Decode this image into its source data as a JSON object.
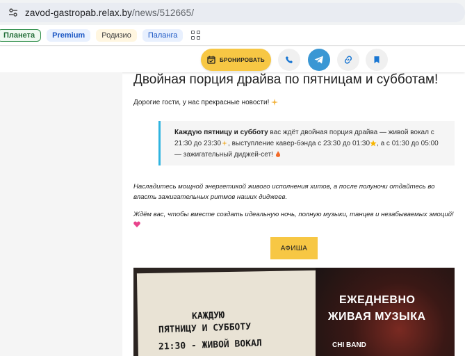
{
  "browser": {
    "url_host": "zavod-gastropab.relax.by",
    "url_path": "/news/512665/"
  },
  "bookmarks": [
    {
      "label": "Планета"
    },
    {
      "label": "Premium"
    },
    {
      "label": "Родизио"
    },
    {
      "label": "Паланга"
    }
  ],
  "actions": {
    "book_label": "БРОНИРОВАТЬ",
    "phone": "phone-icon",
    "telegram": "telegram-icon",
    "link": "link-icon",
    "bookmark": "bookmark-icon"
  },
  "article": {
    "title": "Двойная порция драйва по пятницам и субботам!",
    "intro": "Дорогие гости, у нас прекрасные новости!",
    "quote_bold": "Каждую пятницу и субботу",
    "quote_part1": " вас ждёт двойная порция драйва — живой вокал с 21:30 до 23:30",
    "quote_part2": ", выступление кавер-бэнда с 23:30 до 01:30",
    "quote_part3": ", а с 01:30 до 05:00 — зажигательный диджей-сет!",
    "paragraph1": "Насладитесь мощной энергетикой живого исполнения хитов, а после полуночи отдайтесь во власть зажигательных ритмов наших диджеев.",
    "paragraph2": "Ждём вас, чтобы вместе создать идеальную ночь, полную музыки, танцев и незабываемых эмоций!",
    "afisha_label": "АФИША"
  },
  "poster": {
    "line1": "КАЖДУЮ",
    "line2": "ПЯТНИЦУ И СУББОТУ",
    "line3": "21:30 - ЖИВОЙ ВОКАЛ",
    "head1": "ЕЖЕДНЕВНО",
    "head2": "ЖИВАЯ МУЗЫКА",
    "band": "CHI BAND"
  },
  "colors": {
    "accent_yellow": "#f7c744",
    "quote_border": "#2fb4e0",
    "telegram_blue": "#3a97d4"
  }
}
